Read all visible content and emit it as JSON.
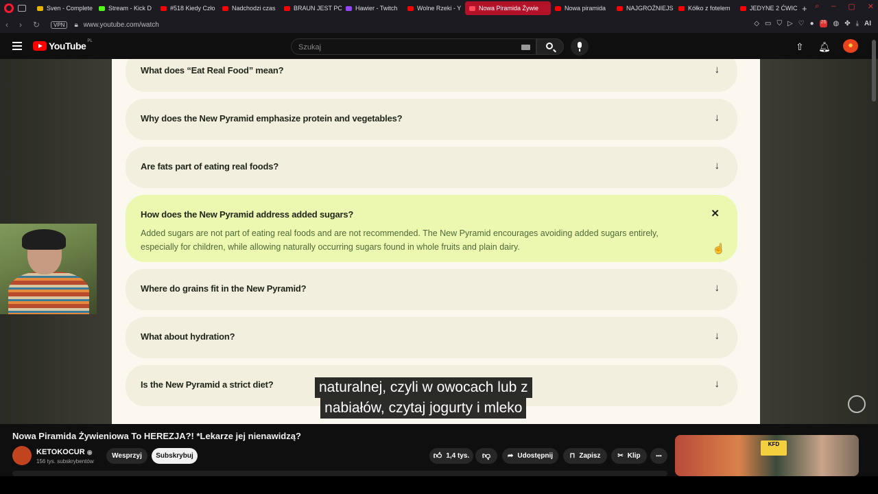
{
  "browser": {
    "tabs": [
      {
        "label": "Sven - Complete",
        "color": "#e8b400"
      },
      {
        "label": "Stream - Kick D",
        "color": "#53fc18"
      },
      {
        "label": "#518 Kiedy Czło",
        "color": "#ff0000"
      },
      {
        "label": "Nadchodzi czas",
        "color": "#ff0000"
      },
      {
        "label": "BRAUN JEST PO",
        "color": "#ff0000"
      },
      {
        "label": "Hawier - Twitch",
        "color": "#9146ff"
      },
      {
        "label": "Wolne Rzeki - Y",
        "color": "#ff0000"
      },
      {
        "label": "Nowa Piramida Żywie",
        "color": "#ff0000",
        "active": true
      },
      {
        "label": "Nowa piramida",
        "color": "#ff0000"
      },
      {
        "label": "NAJGROŹNIEJS",
        "color": "#ff0000"
      },
      {
        "label": "Kółko z fotelem",
        "color": "#ff0000"
      },
      {
        "label": "JEDYNE 2 ĆWIC",
        "color": "#ff0000"
      }
    ],
    "new_tab": "+",
    "vpn": "VPN",
    "url": "www.youtube.com/watch",
    "ext_badge": "26",
    "ai_label": "AI"
  },
  "youtube": {
    "logo": "YouTube",
    "region": "PL",
    "search_placeholder": "Szukaj"
  },
  "faq": [
    {
      "q": "What does “Eat Real Food” mean?"
    },
    {
      "q": "Why does the New Pyramid emphasize protein and vegetables?"
    },
    {
      "q": "Are fats part of eating real foods?"
    },
    {
      "q": "How does the New Pyramid address added sugars?",
      "answer": "Added sugars are not part of eating real foods and are not recommended. The New Pyramid encourages avoiding added sugars entirely, especially for children, while allowing naturally occurring sugars found in whole fruits and plain dairy."
    },
    {
      "q": "Where do grains fit in the New Pyramid?"
    },
    {
      "q": "What about hydration?"
    },
    {
      "q": "Is the New Pyramid a strict diet?"
    }
  ],
  "subtitles": [
    "naturalnej, czyli w owocach lub z",
    "nabiałów, czytaj jogurty i mleko"
  ],
  "video": {
    "title": "Nowa Piramida Żywieniowa To HEREZJA?! *Lekarze jej nienawidzą?",
    "channel": "KETOKOCUR",
    "subscribers": "156 tys. subskrybentów",
    "support": "Wesprzyj",
    "subscribe": "Subskrybuj",
    "likes": "1,4 tys.",
    "share": "Udostępnij",
    "save": "Zapisz",
    "clip": "Klip",
    "more": "•••",
    "thumb_badge": "KFD"
  }
}
